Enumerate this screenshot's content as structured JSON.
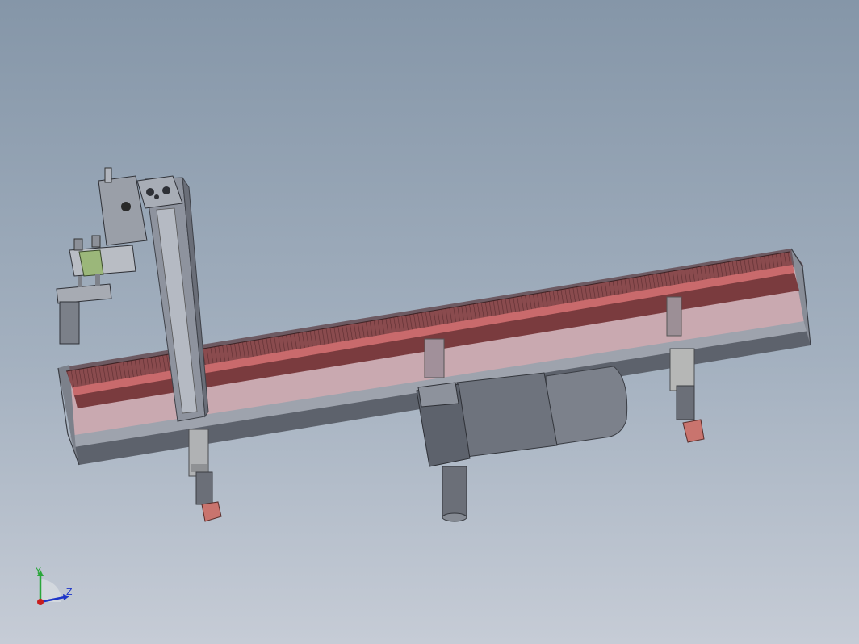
{
  "viewport": {
    "background_top": "#8596a8",
    "background_bottom": "#c6ccd6"
  },
  "model": {
    "parts": [
      "conveyor-frame",
      "conveyor-belt",
      "vertical-aluminum-profile",
      "gripper-assembly",
      "gear-motor",
      "support-legs"
    ],
    "colors": {
      "frame": "#6e7480",
      "belt": "#7a3b3e",
      "belt_top": "#c86b6e",
      "belt_inner": "#c9a9b0",
      "motor": "#7b8089",
      "leg_foot": "#c9746e",
      "gripper_accent": "#9bb77a"
    }
  },
  "triad": {
    "y_label": "Y",
    "z_label": "Z",
    "y_color": "#2aa63a",
    "z_color": "#1d35c8",
    "x_color": "#c81d1d"
  }
}
